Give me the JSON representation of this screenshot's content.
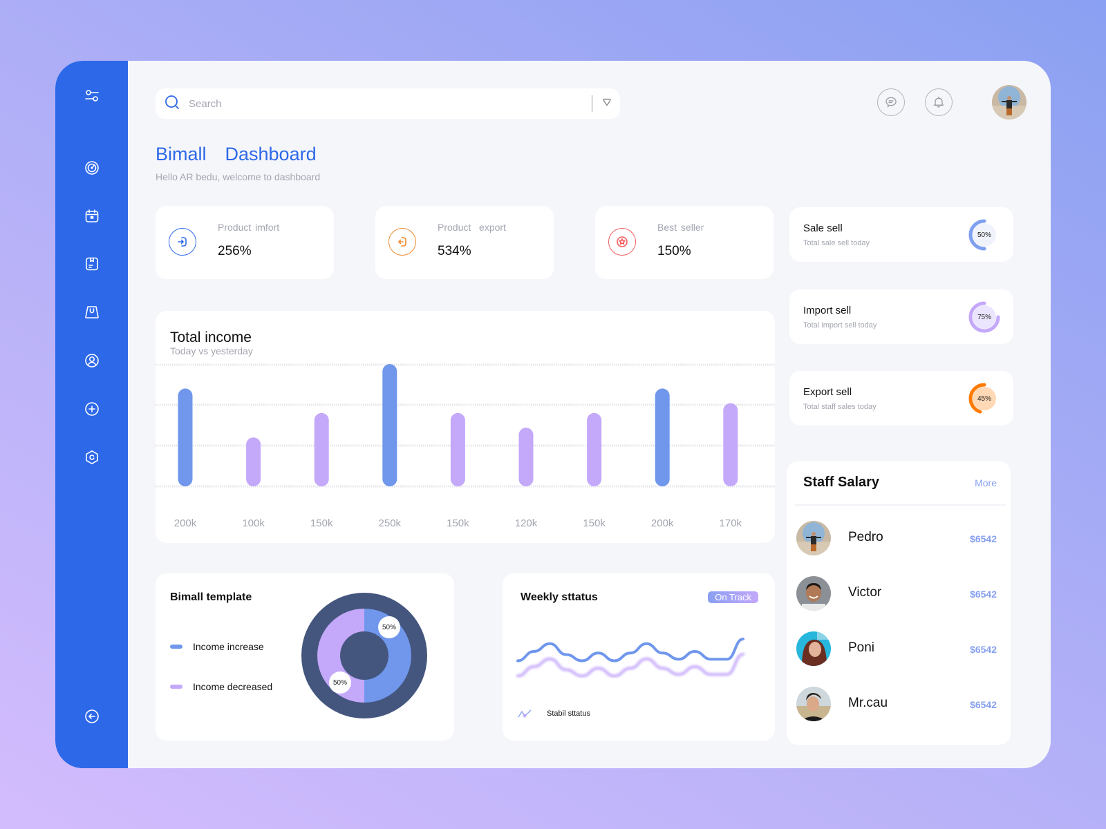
{
  "sidebar": {
    "items": [
      {
        "name": "filter-settings",
        "icon": "sliders-icon"
      },
      {
        "name": "dashboard",
        "icon": "gauge-icon"
      },
      {
        "name": "calendar",
        "icon": "calendar-icon"
      },
      {
        "name": "orders",
        "icon": "document-icon"
      },
      {
        "name": "shop",
        "icon": "shopping-bag-icon"
      },
      {
        "name": "profile",
        "icon": "user-icon"
      },
      {
        "name": "add",
        "icon": "plus-circle-icon"
      },
      {
        "name": "settings",
        "icon": "hexagon-settings-icon"
      }
    ],
    "logout_icon": "logout-arrow-icon"
  },
  "header": {
    "search_placeholder": "Search",
    "search_value": "",
    "icons": [
      "chat-icon",
      "bell-icon"
    ],
    "avatar": "user-avatar"
  },
  "page": {
    "title": "Bimall  Dashboard",
    "subtitle": "Hello AR bedu, welcome to dashboard"
  },
  "stats": [
    {
      "label": "Product imfort",
      "value": "256%",
      "icon": "import-icon",
      "color": "#2d68e8"
    },
    {
      "label": "Product  export",
      "value": "534%",
      "icon": "export-icon",
      "color": "#ee8a2c"
    },
    {
      "label": "Best seller",
      "value": "150%",
      "icon": "star-badge-icon",
      "color": "#ef5d5d"
    }
  ],
  "mini_cards": [
    {
      "title": "Sale sell",
      "subtitle": "Total sale sell today",
      "percent": 50,
      "label": "50%",
      "color": "#7fa0ef",
      "track": "#f1f3fc"
    },
    {
      "title": "Import sell",
      "subtitle": "Total import sell today",
      "percent": 75,
      "label": "75%",
      "color": "#c4a8fa",
      "track": "#ece5ff"
    },
    {
      "title": "Export sell",
      "subtitle": "Total staff sales today",
      "percent": 45,
      "label": "45%",
      "color": "#ff7a00",
      "track": "#ffd9b5"
    }
  ],
  "income": {
    "title": "Total income",
    "subtitle": "Today vs yesterday"
  },
  "template_card": {
    "title": "Bimall template",
    "legend": [
      {
        "label": "Income increase",
        "color": "#7097ec"
      },
      {
        "label": "Income decreased",
        "color": "#c4a8fa"
      }
    ]
  },
  "weekly": {
    "title": "Weekly sttatus",
    "badge": "On Track",
    "legend_label": "Stabil sttatus"
  },
  "salary": {
    "title": "Staff Salary",
    "more_label": "More",
    "staff": [
      {
        "name": "Pedro",
        "amount": "$6542"
      },
      {
        "name": "Victor",
        "amount": "$6542"
      },
      {
        "name": "Poni",
        "amount": "$6542"
      },
      {
        "name": "Mr.cau",
        "amount": "$6542"
      }
    ]
  },
  "chart_data": [
    {
      "type": "bar",
      "title": "Total income",
      "subtitle": "Today vs yesterday",
      "xlabel": "",
      "ylabel": "",
      "categories": [
        "200k",
        "100k",
        "150k",
        "250k",
        "150k",
        "120k",
        "150k",
        "200k",
        "170k"
      ],
      "values": [
        200,
        100,
        150,
        250,
        150,
        120,
        150,
        200,
        170
      ],
      "highlight": [
        true,
        false,
        false,
        true,
        false,
        false,
        false,
        true,
        false
      ],
      "colors": {
        "highlight": "#7097ec",
        "normal": "#c4a8fa"
      },
      "ylim": [
        0,
        250
      ],
      "grid": true,
      "unit": "k"
    },
    {
      "type": "pie",
      "title": "Bimall template",
      "series": [
        {
          "name": "Income increase",
          "value": 50,
          "label": "50%",
          "color": "#7097ec"
        },
        {
          "name": "Income decreased",
          "value": 50,
          "label": "50%",
          "color": "#c4a8fa"
        }
      ],
      "ring_color": "#44567e"
    },
    {
      "type": "line",
      "title": "Weekly sttatus",
      "legend": [
        "Stabil sttatus"
      ],
      "x": [
        0,
        1,
        2,
        3,
        4,
        5,
        6,
        7,
        8,
        9,
        10,
        11,
        12,
        13,
        14
      ],
      "series": [
        {
          "name": "current",
          "values": [
            0.3,
            0.6,
            0.85,
            0.5,
            0.3,
            0.55,
            0.3,
            0.55,
            0.85,
            0.55,
            0.35,
            0.6,
            0.35,
            0.35,
            1.0
          ],
          "color": "#7097ec"
        },
        {
          "name": "previous",
          "values": [
            0.1,
            0.4,
            0.65,
            0.3,
            0.1,
            0.35,
            0.1,
            0.35,
            0.65,
            0.35,
            0.15,
            0.4,
            0.15,
            0.15,
            0.8
          ],
          "color": "#c4a8fa"
        }
      ],
      "ylim": [
        0,
        1
      ]
    }
  ]
}
